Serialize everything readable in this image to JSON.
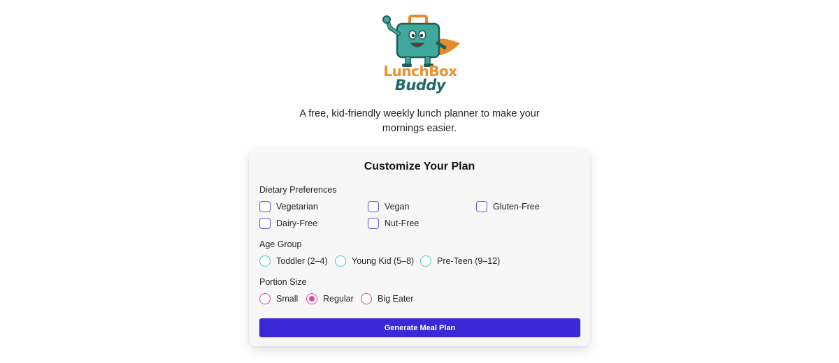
{
  "logo": {
    "word1": "LunchBox",
    "word2": "Buddy",
    "icon": "lunchbox-mascot-icon"
  },
  "tagline": "A free, kid-friendly weekly lunch planner to make your mornings easier.",
  "card": {
    "title": "Customize Your Plan",
    "dietary": {
      "label": "Dietary Preferences",
      "options": [
        {
          "label": "Vegetarian",
          "checked": false
        },
        {
          "label": "Vegan",
          "checked": false
        },
        {
          "label": "Gluten-Free",
          "checked": false
        },
        {
          "label": "Dairy-Free",
          "checked": false
        },
        {
          "label": "Nut-Free",
          "checked": false
        }
      ]
    },
    "age": {
      "label": "Age Group",
      "options": [
        {
          "label": "Toddler (2–4)",
          "selected": false
        },
        {
          "label": "Young Kid (5–8)",
          "selected": false
        },
        {
          "label": "Pre-Teen (9–12)",
          "selected": false
        }
      ]
    },
    "portion": {
      "label": "Portion Size",
      "options": [
        {
          "label": "Small",
          "selected": false
        },
        {
          "label": "Regular",
          "selected": true
        },
        {
          "label": "Big Eater",
          "selected": false
        }
      ]
    },
    "button_label": "Generate Meal Plan"
  },
  "colors": {
    "checkbox_border": "#5b57d6",
    "age_radio_border": "#49c9c4",
    "portion_radio_border": "#e0489a",
    "button_bg": "#3b28d6",
    "logo_orange": "#e8912e",
    "logo_teal": "#1e6a6a"
  }
}
